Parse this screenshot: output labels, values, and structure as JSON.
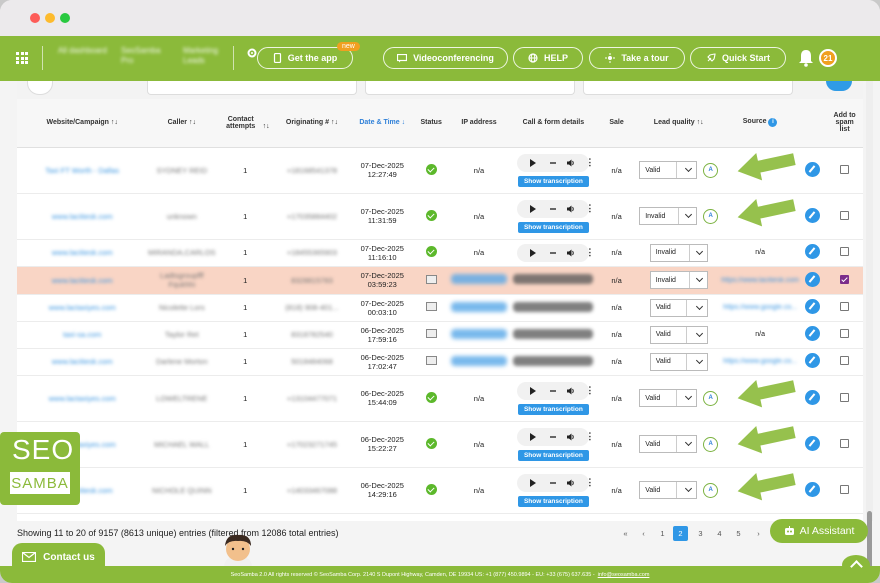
{
  "nav": {
    "blurred_items": [
      "All dashboard",
      "SeoSamba Pro",
      "Marketing Leads"
    ],
    "get_app": "Get the app",
    "new_badge": "new",
    "videoconferencing": "Videoconferencing",
    "help": "HELP",
    "take_tour": "Take a tour",
    "quick_start": "Quick Start",
    "notification_count": "21"
  },
  "table": {
    "headers": {
      "website": "Website/Campaign",
      "caller": "Caller",
      "contact_attempts": "Contact attempts",
      "originating": "Originating #",
      "date_time": "Date & Time",
      "status": "Status",
      "ip": "IP address",
      "call_form": "Call & form details",
      "sale": "Sale",
      "lead_quality": "Lead quality",
      "source": "Source",
      "add_spam": "Add to spam list"
    },
    "show_transcription": "Show transcription",
    "rows": [
      {
        "website": "Taxi FT Worth - Dallas",
        "caller": "SYDNEY REID",
        "attempts": "1",
        "orig": "+18168541378",
        "date": "07-Dec-2025",
        "time": "12:27:49",
        "status": "check",
        "ip": "n/a",
        "detail": "audio",
        "sale": "n/a",
        "quality": "Valid",
        "ai": true,
        "source": "",
        "spam": false,
        "hl": false
      },
      {
        "website": "www.lacitiesk.com",
        "caller": "unknown",
        "attempts": "1",
        "orig": "+17035884402",
        "date": "07-Dec-2025",
        "time": "11:31:59",
        "status": "check",
        "ip": "n/a",
        "detail": "audio",
        "sale": "n/a",
        "quality": "Invalid",
        "ai": true,
        "source": "",
        "spam": false,
        "hl": false
      },
      {
        "website": "www.lacitiesk.com",
        "caller": "MIRANDA,CARLOS",
        "attempts": "1",
        "orig": "+18455365903",
        "date": "07-Dec-2025",
        "time": "11:16:10",
        "status": "check",
        "ip": "n/a",
        "detail": "audio-only",
        "sale": "n/a",
        "quality": "Invalid",
        "ai": false,
        "source": "n/a",
        "spam": false,
        "hl": false
      },
      {
        "website": "www.lacitiesk.com",
        "caller": "Ladtsgroupfff Fqukhhi",
        "attempts": "1",
        "orig": "8328815783",
        "date": "07-Dec-2025",
        "time": "03:59:23",
        "status": "form",
        "ip": "blurred",
        "detail": "email",
        "sale": "n/a",
        "quality": "Invalid",
        "ai": false,
        "source": "https://www.lacitiesk.com",
        "spam": true,
        "hl": true
      },
      {
        "website": "www.lactaxiyes.com",
        "caller": "Nicolette Lors",
        "attempts": "1",
        "orig": "(818) 908-401...",
        "date": "07-Dec-2025",
        "time": "00:03:10",
        "status": "form",
        "ip": "blurred",
        "detail": "email",
        "sale": "n/a",
        "quality": "Valid",
        "ai": false,
        "source": "https://www.google.co...",
        "spam": false,
        "hl": false
      },
      {
        "website": "taxi-sa.com",
        "caller": "Taylor Ret",
        "attempts": "1",
        "orig": "8318782540",
        "date": "06-Dec-2025",
        "time": "17:59:16",
        "status": "form",
        "ip": "blurred",
        "detail": "email",
        "sale": "n/a",
        "quality": "Valid",
        "ai": false,
        "source": "n/a",
        "spam": false,
        "hl": false
      },
      {
        "website": "www.lacitiesk.com",
        "caller": "Darlene Morton",
        "attempts": "1",
        "orig": "5018484068",
        "date": "06-Dec-2025",
        "time": "17:02:47",
        "status": "form",
        "ip": "blurred",
        "detail": "email",
        "sale": "n/a",
        "quality": "Valid",
        "ai": false,
        "source": "https://www.google.co...",
        "spam": false,
        "hl": false
      },
      {
        "website": "www.lactaxiyes.com",
        "caller": "LOWELTRENE",
        "attempts": "1",
        "orig": "+13104477071",
        "date": "06-Dec-2025",
        "time": "15:44:09",
        "status": "check",
        "ip": "n/a",
        "detail": "audio",
        "sale": "n/a",
        "quality": "Valid",
        "ai": true,
        "source": "",
        "spam": false,
        "hl": false
      },
      {
        "website": "www.lactaxiyes.com",
        "caller": "MICHAEL WALL",
        "attempts": "1",
        "orig": "+17023271745",
        "date": "06-Dec-2025",
        "time": "15:22:27",
        "status": "check",
        "ip": "n/a",
        "detail": "audio",
        "sale": "n/a",
        "quality": "Valid",
        "ai": true,
        "source": "",
        "spam": false,
        "hl": false
      },
      {
        "website": "www.lacitiesk.com",
        "caller": "NICHOLE QUINN",
        "attempts": "1",
        "orig": "+14033467088",
        "date": "06-Dec-2025",
        "time": "14:29:16",
        "status": "check",
        "ip": "n/a",
        "detail": "audio",
        "sale": "n/a",
        "quality": "Valid",
        "ai": true,
        "source": "",
        "spam": false,
        "hl": false
      }
    ]
  },
  "footer": {
    "entries_text": "Showing 11 to 20 of 9157 (8613 unique) entries (filtered from 12086 total entries)",
    "pager": [
      "«",
      "‹",
      "1",
      "2",
      "3",
      "4",
      "5",
      "›"
    ],
    "current_page": "2",
    "ai_assistant": "AI Assistant",
    "contact_us": "Contact us",
    "copyright": "SeoSamba 2.0  All rights reserved © SeoSamba Corp. 2140 S Dupont Highway, Camden, DE 19934 US: +1 (877) 450.9894 - EU: +33 (675) 637.635 -",
    "email": "info@seosamba.com",
    "logo_top": "SEO",
    "logo_bottom": "SAMBA"
  },
  "colors": {
    "brand_green": "#8bba3a",
    "accent_blue": "#2f97e6",
    "highlight_row": "#f9d5c5",
    "badge_orange": "#f0a020"
  }
}
